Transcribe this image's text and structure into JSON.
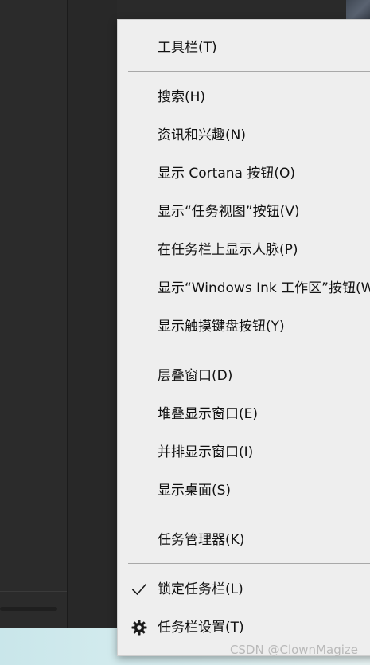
{
  "context_menu": {
    "items": [
      {
        "label": "工具栏(T)"
      },
      {
        "label": "搜索(H)"
      },
      {
        "label": "资讯和兴趣(N)"
      },
      {
        "label": "显示 Cortana 按钮(O)"
      },
      {
        "label": "显示“任务视图”按钮(V)"
      },
      {
        "label": "在任务栏上显示人脉(P)"
      },
      {
        "label": "显示“Windows Ink 工作区”按钮(W)"
      },
      {
        "label": "显示触摸键盘按钮(Y)"
      },
      {
        "label": "层叠窗口(D)"
      },
      {
        "label": "堆叠显示窗口(E)"
      },
      {
        "label": "并排显示窗口(I)"
      },
      {
        "label": "显示桌面(S)"
      },
      {
        "label": "任务管理器(K)"
      },
      {
        "label": "锁定任务栏(L)",
        "checked": true,
        "icon": "checkmark-icon"
      },
      {
        "label": "任务栏设置(T)",
        "icon": "gear-icon"
      }
    ]
  },
  "watermark": {
    "text": "CSDN @ClownMagize"
  },
  "colors": {
    "menu_background": "#eeeeee",
    "menu_text": "#111111",
    "separator": "#a8a8a8",
    "desktop_dark": "#2b2b2b"
  }
}
